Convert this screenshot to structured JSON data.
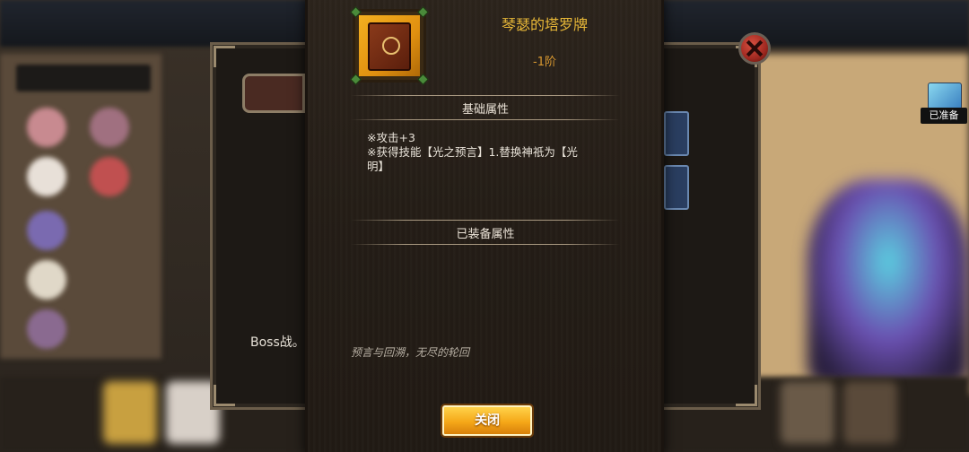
{
  "popup": {
    "item_name": "琴瑟的塔罗牌",
    "item_rank": "-1阶",
    "section_base": "基础属性",
    "attr_line_1": "※攻击+3",
    "attr_line_2": "※获得技能【光之预言】1.替换神祇为【光",
    "attr_line_3": "明】",
    "section_equipped": "已装备属性",
    "flavor_text": "预言与回溯，无尽的轮回",
    "close_label": "关闭"
  },
  "background": {
    "underlying_text": "Boss战。",
    "ready_badge_label": "已准备"
  },
  "colors": {
    "item_name": "#e8b838",
    "item_rank": "#d89830",
    "close_button": "#f5a818",
    "popup_bg": "#2c241c"
  },
  "icons": {
    "item_icon": "tarot-card-icon",
    "dialog_close": "close-x-icon"
  }
}
